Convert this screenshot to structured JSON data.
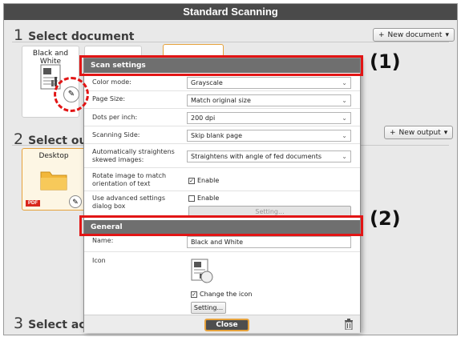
{
  "window": {
    "title": "Standard Scanning"
  },
  "sections": {
    "select_document": {
      "num": "1",
      "label": "Select document",
      "button": "New document"
    },
    "select_output": {
      "num": "2",
      "label": "Select out",
      "button": "New output"
    },
    "select_action": {
      "num": "3",
      "label": "Select act"
    }
  },
  "cards": {
    "document": "Black and White",
    "output": "Desktop",
    "output_badge": "PDF"
  },
  "dialog": {
    "scan_settings_header": "Scan settings",
    "rows": {
      "color_mode": {
        "label": "Color mode:",
        "value": "Grayscale"
      },
      "page_size": {
        "label": "Page Size:",
        "value": "Match original size"
      },
      "dpi": {
        "label": "Dots per inch:",
        "value": "200 dpi"
      },
      "scanning_side": {
        "label": "Scanning Side:",
        "value": "Skip blank page"
      },
      "straighten": {
        "label": "Automatically straightens skewed images:",
        "value": "Straightens with angle of fed documents"
      },
      "rotate": {
        "label": "Rotate image to match orientation of text",
        "option": "Enable",
        "checked": true
      },
      "advanced": {
        "label": "Use advanced settings dialog box",
        "option": "Enable",
        "checked": false,
        "button": "Setting..."
      }
    },
    "general_header": "General",
    "name": {
      "label": "Name:",
      "value": "Black and White"
    },
    "icon": {
      "label": "Icon",
      "change_option": "Change the icon",
      "checked": true,
      "button": "Setting..."
    },
    "close_button": "Close"
  },
  "annotations": {
    "callout1": "(1)",
    "callout2": "(2)"
  },
  "colors": {
    "highlight": "#e21515",
    "header": "#6f6f6f",
    "accent_border": "#e6a23c"
  }
}
